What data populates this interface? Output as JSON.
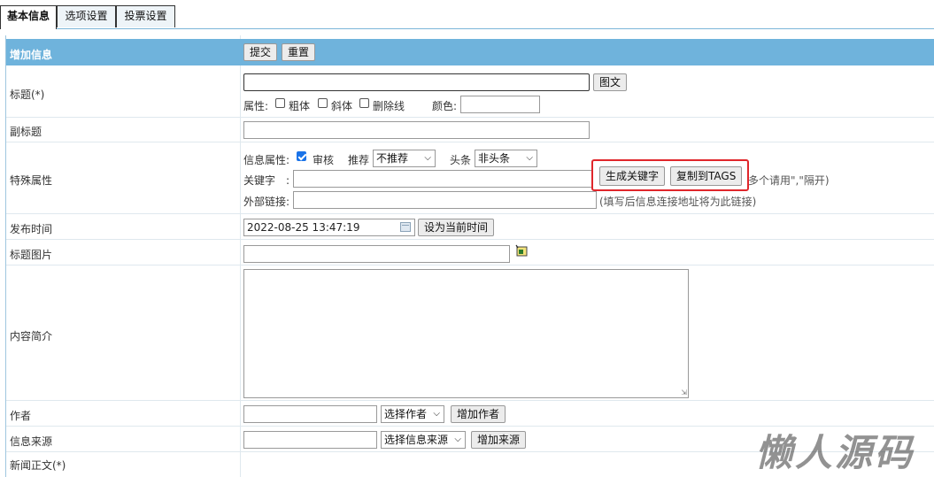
{
  "tabs": [
    {
      "label": "基本信息",
      "active": true
    },
    {
      "label": "选项设置",
      "active": false
    },
    {
      "label": "投票设置",
      "active": false
    }
  ],
  "header": {
    "title": "增加信息",
    "submit": "提交",
    "reset": "重置"
  },
  "title_row": {
    "label": "标题(*)",
    "image_text_button": "图文",
    "attr_label": "属性:",
    "bold": "粗体",
    "italic": "斜体",
    "strike": "删除线",
    "color_label": "颜色:"
  },
  "subtitle_row": {
    "label": "副标题"
  },
  "special_row": {
    "label": "特殊属性",
    "info_attr_label": "信息属性:",
    "review_label": "审核",
    "review_checked": true,
    "recommend_label": "推荐",
    "recommend_value": "不推荐",
    "headline_label": "头条",
    "headline_value": "非头条",
    "keyword_label": "关键字　:",
    "gen_keyword_button": "生成关键字",
    "copy_tags_button": "复制到TAGS",
    "keyword_hint": "多个请用\",\"隔开)",
    "external_label": "外部链接:",
    "external_hint": "(填写后信息连接地址将为此链接)"
  },
  "publish_row": {
    "label": "发布时间",
    "value": "2022-08-25 13:47:19",
    "set_now_button": "设为当前时间"
  },
  "title_image_row": {
    "label": "标题图片"
  },
  "summary_row": {
    "label": "内容简介"
  },
  "author_row": {
    "label": "作者",
    "select_value": "选择作者",
    "add_button": "增加作者"
  },
  "source_row": {
    "label": "信息来源",
    "select_value": "选择信息来源",
    "add_button": "增加来源"
  },
  "content_row": {
    "label": "新闻正文(*)"
  },
  "watermark": "懒人源码",
  "colors": {
    "header_bg": "#6fb3dc",
    "highlight": "#e0262b",
    "checkbox": "#1a73e8"
  }
}
